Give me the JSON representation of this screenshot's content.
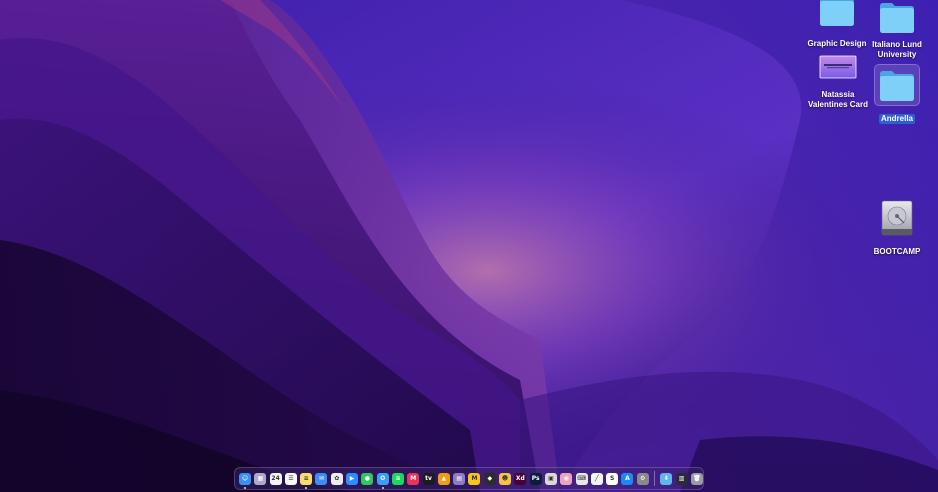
{
  "colors": {
    "folder_light": "#7fd0f8",
    "folder_dark": "#4aa6e0",
    "selection": "#2f5fd0",
    "wallpaper_bg": "#2a1070"
  },
  "desktop": {
    "icons": [
      {
        "name": "folder-graphic-design",
        "label": "Graphic Design",
        "icon": "folder-icon",
        "selected": false
      },
      {
        "name": "folder-italiano-lund",
        "label": "Italiano Lund\nUniversity",
        "icon": "folder-icon",
        "selected": false
      },
      {
        "name": "file-natassia-card",
        "label": "Natassia\nValentines Card",
        "icon": "image-file-icon",
        "selected": false
      },
      {
        "name": "folder-andrella",
        "label": "Andrella",
        "icon": "folder-icon",
        "selected": true
      },
      {
        "name": "drive-bootcamp",
        "label": "BOOTCAMP",
        "icon": "hard-drive-icon",
        "selected": false
      }
    ]
  },
  "dock": {
    "apps": [
      {
        "icon": "finder-icon",
        "color": "#3a8ff0",
        "glyph": "☺",
        "running": true
      },
      {
        "icon": "launchpad-icon",
        "color": "#b0a8c8",
        "glyph": "▦",
        "running": false
      },
      {
        "icon": "calendar-icon",
        "color": "#f4f4f4",
        "glyph": "24",
        "running": false
      },
      {
        "icon": "reminders-icon",
        "color": "#f8f8f8",
        "glyph": "☰",
        "running": false
      },
      {
        "icon": "notes-icon",
        "color": "#f7dc6f",
        "glyph": "≡",
        "running": true
      },
      {
        "icon": "mail-icon",
        "color": "#3c8ef2",
        "glyph": "✉",
        "running": false
      },
      {
        "icon": "photos-icon",
        "color": "#eeeeee",
        "glyph": "✿",
        "running": false
      },
      {
        "icon": "zoom-icon",
        "color": "#2d8cff",
        "glyph": "▶",
        "running": false
      },
      {
        "icon": "messages-icon",
        "color": "#32c759",
        "glyph": "●",
        "running": false
      },
      {
        "icon": "safari-icon",
        "color": "#3a9ef5",
        "glyph": "✪",
        "running": true
      },
      {
        "icon": "spotify-icon",
        "color": "#1ed760",
        "glyph": "≋",
        "running": false
      },
      {
        "icon": "monday-icon",
        "color": "#e8345a",
        "glyph": "M",
        "running": false
      },
      {
        "icon": "appletv-icon",
        "color": "#1c1c1e",
        "glyph": "tv",
        "running": false
      },
      {
        "icon": "vlc-icon",
        "color": "#f39c12",
        "glyph": "▲",
        "running": false
      },
      {
        "icon": "clapper-icon",
        "color": "#8e7cc3",
        "glyph": "▤",
        "running": false
      },
      {
        "icon": "miro-icon",
        "color": "#f5c518",
        "glyph": "M",
        "running": false
      },
      {
        "icon": "figma-icon",
        "color": "#2c2c2c",
        "glyph": "◆",
        "running": false
      },
      {
        "icon": "emoji-icon",
        "color": "#f6c343",
        "glyph": "☻",
        "running": false
      },
      {
        "icon": "adobe-xd-icon",
        "color": "#470137",
        "glyph": "Xd",
        "running": false
      },
      {
        "icon": "photoshop-icon",
        "color": "#0a1e3c",
        "glyph": "Ps",
        "running": false
      },
      {
        "icon": "preview-icon",
        "color": "#d9d9d9",
        "glyph": "▣",
        "running": false
      },
      {
        "icon": "color-picker-icon",
        "color": "#f0a0c0",
        "glyph": "◉",
        "running": false
      },
      {
        "icon": "keyboard-viewer-icon",
        "color": "#e8e8e8",
        "glyph": "⌨",
        "running": false
      },
      {
        "icon": "script-editor-icon",
        "color": "#f5f5f5",
        "glyph": "╱",
        "running": false
      },
      {
        "icon": "inkscape-icon",
        "color": "#ffffff",
        "glyph": "S",
        "running": false
      },
      {
        "icon": "app-store-icon",
        "color": "#1e88f5",
        "glyph": "A",
        "running": false
      },
      {
        "icon": "system-preferences-icon",
        "color": "#8a8a8a",
        "glyph": "⚙",
        "running": false
      }
    ],
    "right": [
      {
        "icon": "downloads-folder-icon",
        "color": "#5fb6ee",
        "glyph": "⬇",
        "running": false
      },
      {
        "icon": "recent-items-icon",
        "color": "#2a2a3a",
        "glyph": "▥",
        "running": false
      },
      {
        "icon": "trash-icon",
        "color": "#9a9aa8",
        "glyph": "🗑",
        "running": false
      }
    ]
  }
}
